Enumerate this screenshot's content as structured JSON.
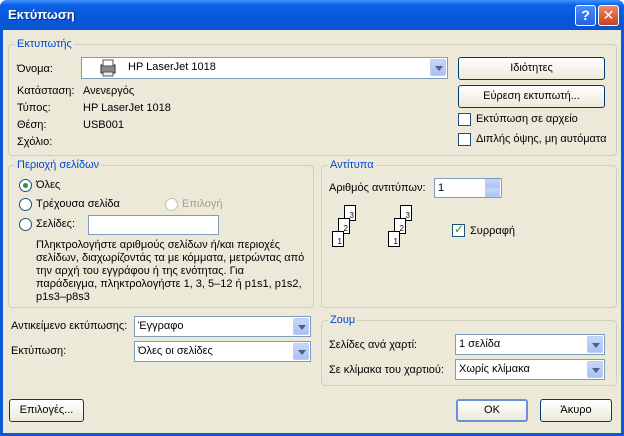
{
  "title": "Εκτύπωση",
  "printer": {
    "legend": "Εκτυπωτής",
    "name_label": "Όνομα:",
    "name_value": "HP LaserJet 1018",
    "status_label": "Κατάσταση:",
    "status_value": "Ανενεργός",
    "type_label": "Τύπος:",
    "type_value": "HP LaserJet 1018",
    "where_label": "Θέση:",
    "where_value": "USB001",
    "comment_label": "Σχόλιο:",
    "properties_button": "Ιδιότητες",
    "find_button": "Εύρεση εκτυπωτή...",
    "print_to_file": "Εκτύπωση σε αρχείο",
    "duplex": "Διπλής όψης, μη αυτόματα"
  },
  "range": {
    "legend": "Περιοχή σελίδων",
    "all": "Όλες",
    "current": "Τρέχουσα σελίδα",
    "selection": "Επιλογή",
    "pages": "Σελίδες:",
    "help_text": "Πληκτρολογήστε αριθμούς σελίδων ή/και περιοχές σελίδων, διαχωρίζοντάς τα με κόμματα, μετρώντας από την αρχή του εγγράφου ή της ενότητας. Για παράδειγμα, πληκτρολογήστε 1, 3, 5–12 ή p1s1, p1s2, p1s3–p8s3"
  },
  "copies": {
    "legend": "Αντίτυπα",
    "count_label": "Αριθμός αντιτύπων:",
    "count_value": "1",
    "collate": "Συρραφή",
    "collate_checked": true
  },
  "print_what_label": "Αντικείμενο εκτύπωσης:",
  "print_what_value": "Έγγραφο",
  "print_label": "Εκτύπωση:",
  "print_value": "Όλες οι σελίδες",
  "zoom": {
    "legend": "Ζουμ",
    "pages_per_sheet_label": "Σελίδες ανά χαρτί:",
    "pages_per_sheet_value": "1 σελίδα",
    "scale_label": "Σε κλίμακα του χαρτιού:",
    "scale_value": "Χωρίς κλίμακα"
  },
  "buttons": {
    "options": "Επιλογές...",
    "ok": "OK",
    "cancel": "Άκυρο"
  }
}
